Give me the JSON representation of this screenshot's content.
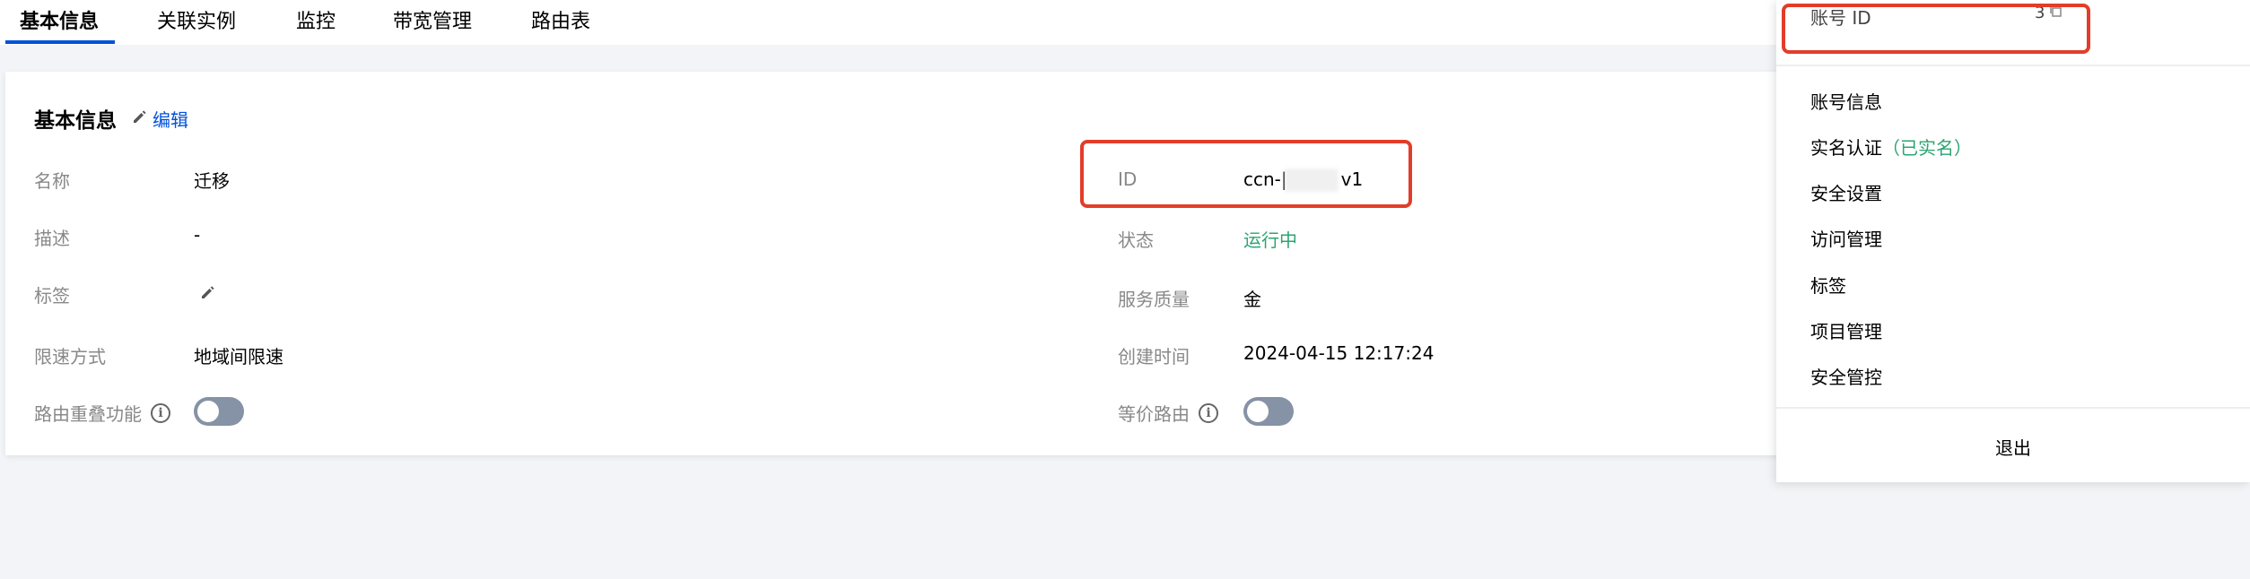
{
  "tabs": [
    {
      "label": "基本信息",
      "active": true
    },
    {
      "label": "关联实例",
      "active": false
    },
    {
      "label": "监控",
      "active": false
    },
    {
      "label": "带宽管理",
      "active": false
    },
    {
      "label": "路由表",
      "active": false
    }
  ],
  "basic_info": {
    "title": "基本信息",
    "edit_label": "编辑",
    "left": {
      "name_label": "名称",
      "name_value": "迁移",
      "desc_label": "描述",
      "desc_value": "-",
      "tag_label": "标签",
      "rate_label": "限速方式",
      "rate_value": "地域间限速",
      "route_overlap_label": "路由重叠功能",
      "route_overlap_enabled": false
    },
    "right": {
      "id_label": "ID",
      "id_value_prefix": "ccn-|",
      "id_value_suffix": "v1",
      "status_label": "状态",
      "status_value": "运行中",
      "qos_label": "服务质量",
      "qos_value": "金",
      "created_label": "创建时间",
      "created_value": "2024-04-15 12:17:24",
      "ecmp_label": "等价路由",
      "ecmp_enabled": false
    }
  },
  "account_menu": {
    "account_id_label": "账号 ID",
    "account_id_partial": "3",
    "items": [
      {
        "label": "账号信息"
      },
      {
        "label": "实名认证",
        "tag": "（已实名）"
      },
      {
        "label": "安全设置"
      },
      {
        "label": "访问管理"
      },
      {
        "label": "标签"
      },
      {
        "label": "项目管理"
      },
      {
        "label": "安全管控"
      }
    ],
    "logout_label": "退出"
  },
  "colors": {
    "accent": "#0052d9",
    "success": "#2ba471",
    "highlight": "#e23d2a",
    "toggle_off": "#8692a5"
  }
}
